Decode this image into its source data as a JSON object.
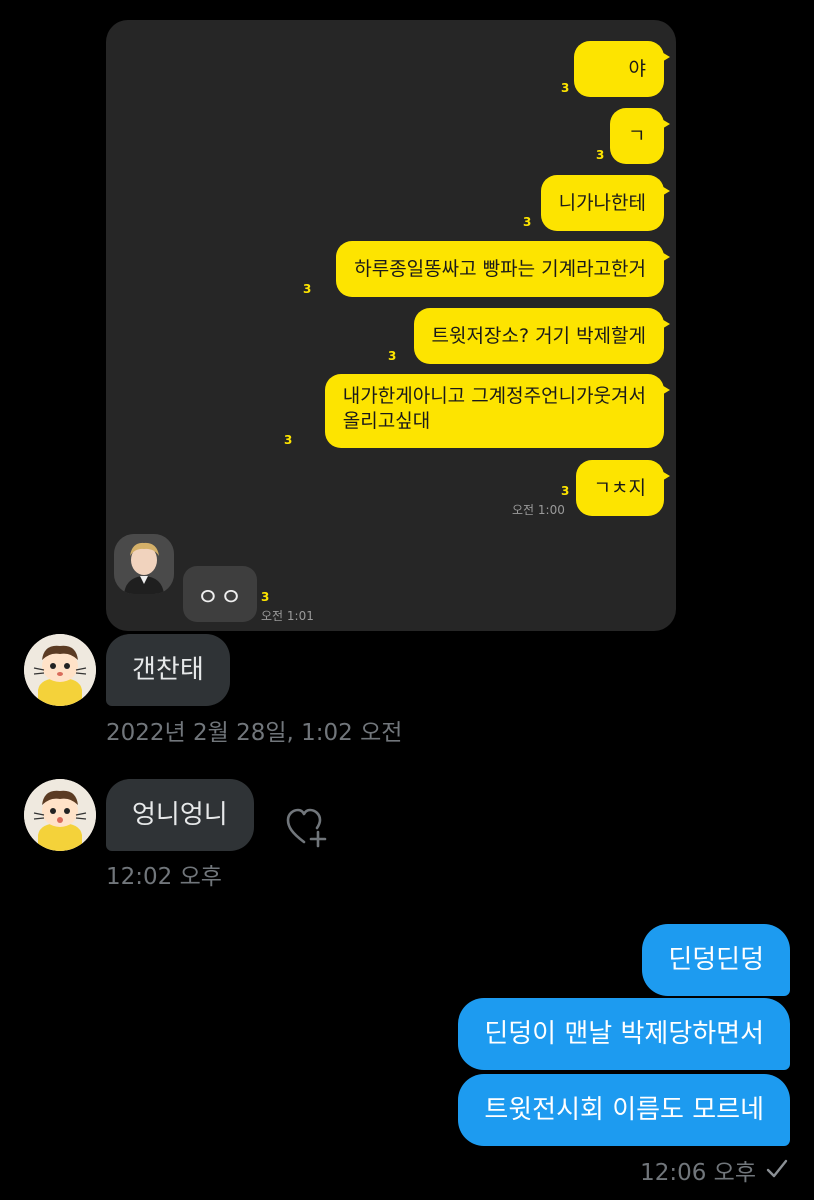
{
  "screenshot": {
    "messages": [
      {
        "text": "야",
        "unread": "3"
      },
      {
        "text": "ㄱ",
        "unread": "3"
      },
      {
        "text": "니가나한테",
        "unread": "3"
      },
      {
        "text": "하루종일똥싸고 빵파는 기계라고한거",
        "unread": "3"
      },
      {
        "text": "트윗저장소? 거기 박제할게",
        "unread": "3"
      },
      {
        "text": "내가한게아니고 그계정주언니가웃겨서",
        "text2": "올리고싶대",
        "unread": "3"
      },
      {
        "text": "ㄱㅊ지",
        "unread": "3",
        "time": "오전 1:00"
      }
    ],
    "reply": {
      "text": "ㅇㅇ",
      "unread": "3",
      "time": "오전 1:01"
    }
  },
  "dm": {
    "incoming1": {
      "text": "갠찬태",
      "timestamp": "2022년 2월 28일, 1:02 오전"
    },
    "incoming2": {
      "text": "엉니엉니",
      "timestamp": "12:02 오후"
    },
    "outgoing": [
      {
        "text": "딘덩딘덩"
      },
      {
        "text": "딘덩이 맨날 박제당하면서"
      },
      {
        "text": "트윗전시회 이름도 모르네"
      }
    ],
    "outgoing_time": "12:06 오후",
    "seen_icon": "checkmark-icon",
    "reaction_icon": "heart-plus-icon"
  }
}
